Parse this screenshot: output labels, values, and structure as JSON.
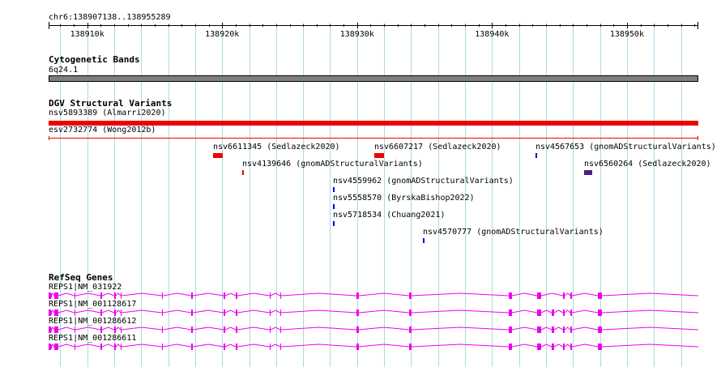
{
  "colors": {
    "gridline": "#add8e6",
    "axis": "#000000",
    "cytoband": "#7f7f7f",
    "sv_loss": "#ee0000",
    "sv_gain": "#0000cc",
    "sv_complex": "#551a8b",
    "gene": "#ee00ee"
  },
  "ruler": {
    "region_label": "chr6:138907138..138955289",
    "start": 138907138,
    "end": 138955289,
    "ticks": [
      {
        "pos": 138910000,
        "label": "138910k"
      },
      {
        "pos": 138920000,
        "label": "138920k"
      },
      {
        "pos": 138930000,
        "label": "138930k"
      },
      {
        "pos": 138940000,
        "label": "138940k"
      },
      {
        "pos": 138950000,
        "label": "138950k"
      }
    ]
  },
  "tracks": {
    "cytobands": {
      "title": "Cytogenetic Bands",
      "band_label": "6q24.1"
    },
    "dgv": {
      "title": "DGV Structural Variants",
      "features": [
        {
          "label": "nsv5893389 (Almarri2020)",
          "start": 138907138,
          "end": 138955289,
          "type": "loss-wide"
        },
        {
          "label": "esv2732774 (Wong2012b)",
          "start": 138907138,
          "end": 138955289,
          "type": "loss-line"
        },
        {
          "label": "nsv6611345 (Sedlazeck2020)",
          "start": 138919300,
          "end": 138920000,
          "type": "loss"
        },
        {
          "label": "nsv6607217 (Sedlazeck2020)",
          "start": 138931300,
          "end": 138932000,
          "type": "loss"
        },
        {
          "label": "nsv4567653 (gnomADStructuralVariants)",
          "start": 138943200,
          "end": 138943300,
          "type": "gain"
        },
        {
          "label": "nsv4139646 (gnomADStructuralVariants)",
          "start": 138921500,
          "end": 138921600,
          "type": "loss"
        },
        {
          "label": "nsv6560264 (Sedlazeck2020)",
          "start": 138946800,
          "end": 138947400,
          "type": "complex"
        },
        {
          "label": "nsv4559962 (gnomADStructuralVariants)",
          "start": 138928200,
          "end": 138928300,
          "type": "gain"
        },
        {
          "label": "nsv5558570 (ByrskaBishop2022)",
          "start": 138928200,
          "end": 138928300,
          "type": "gain"
        },
        {
          "label": "nsv5718534 (Chuang2021)",
          "start": 138928200,
          "end": 138928300,
          "type": "gain"
        },
        {
          "label": "nsv4570777 (gnomADStructuralVariants)",
          "start": 138934900,
          "end": 138935000,
          "type": "gain"
        }
      ]
    },
    "refseq": {
      "title": "RefSeq Genes",
      "transcripts": [
        {
          "label": "REPS1|NM_031922"
        },
        {
          "label": "REPS1|NM_001128617"
        },
        {
          "label": "REPS1|NM_001286612"
        },
        {
          "label": "REPS1|NM_001286611"
        }
      ]
    }
  }
}
